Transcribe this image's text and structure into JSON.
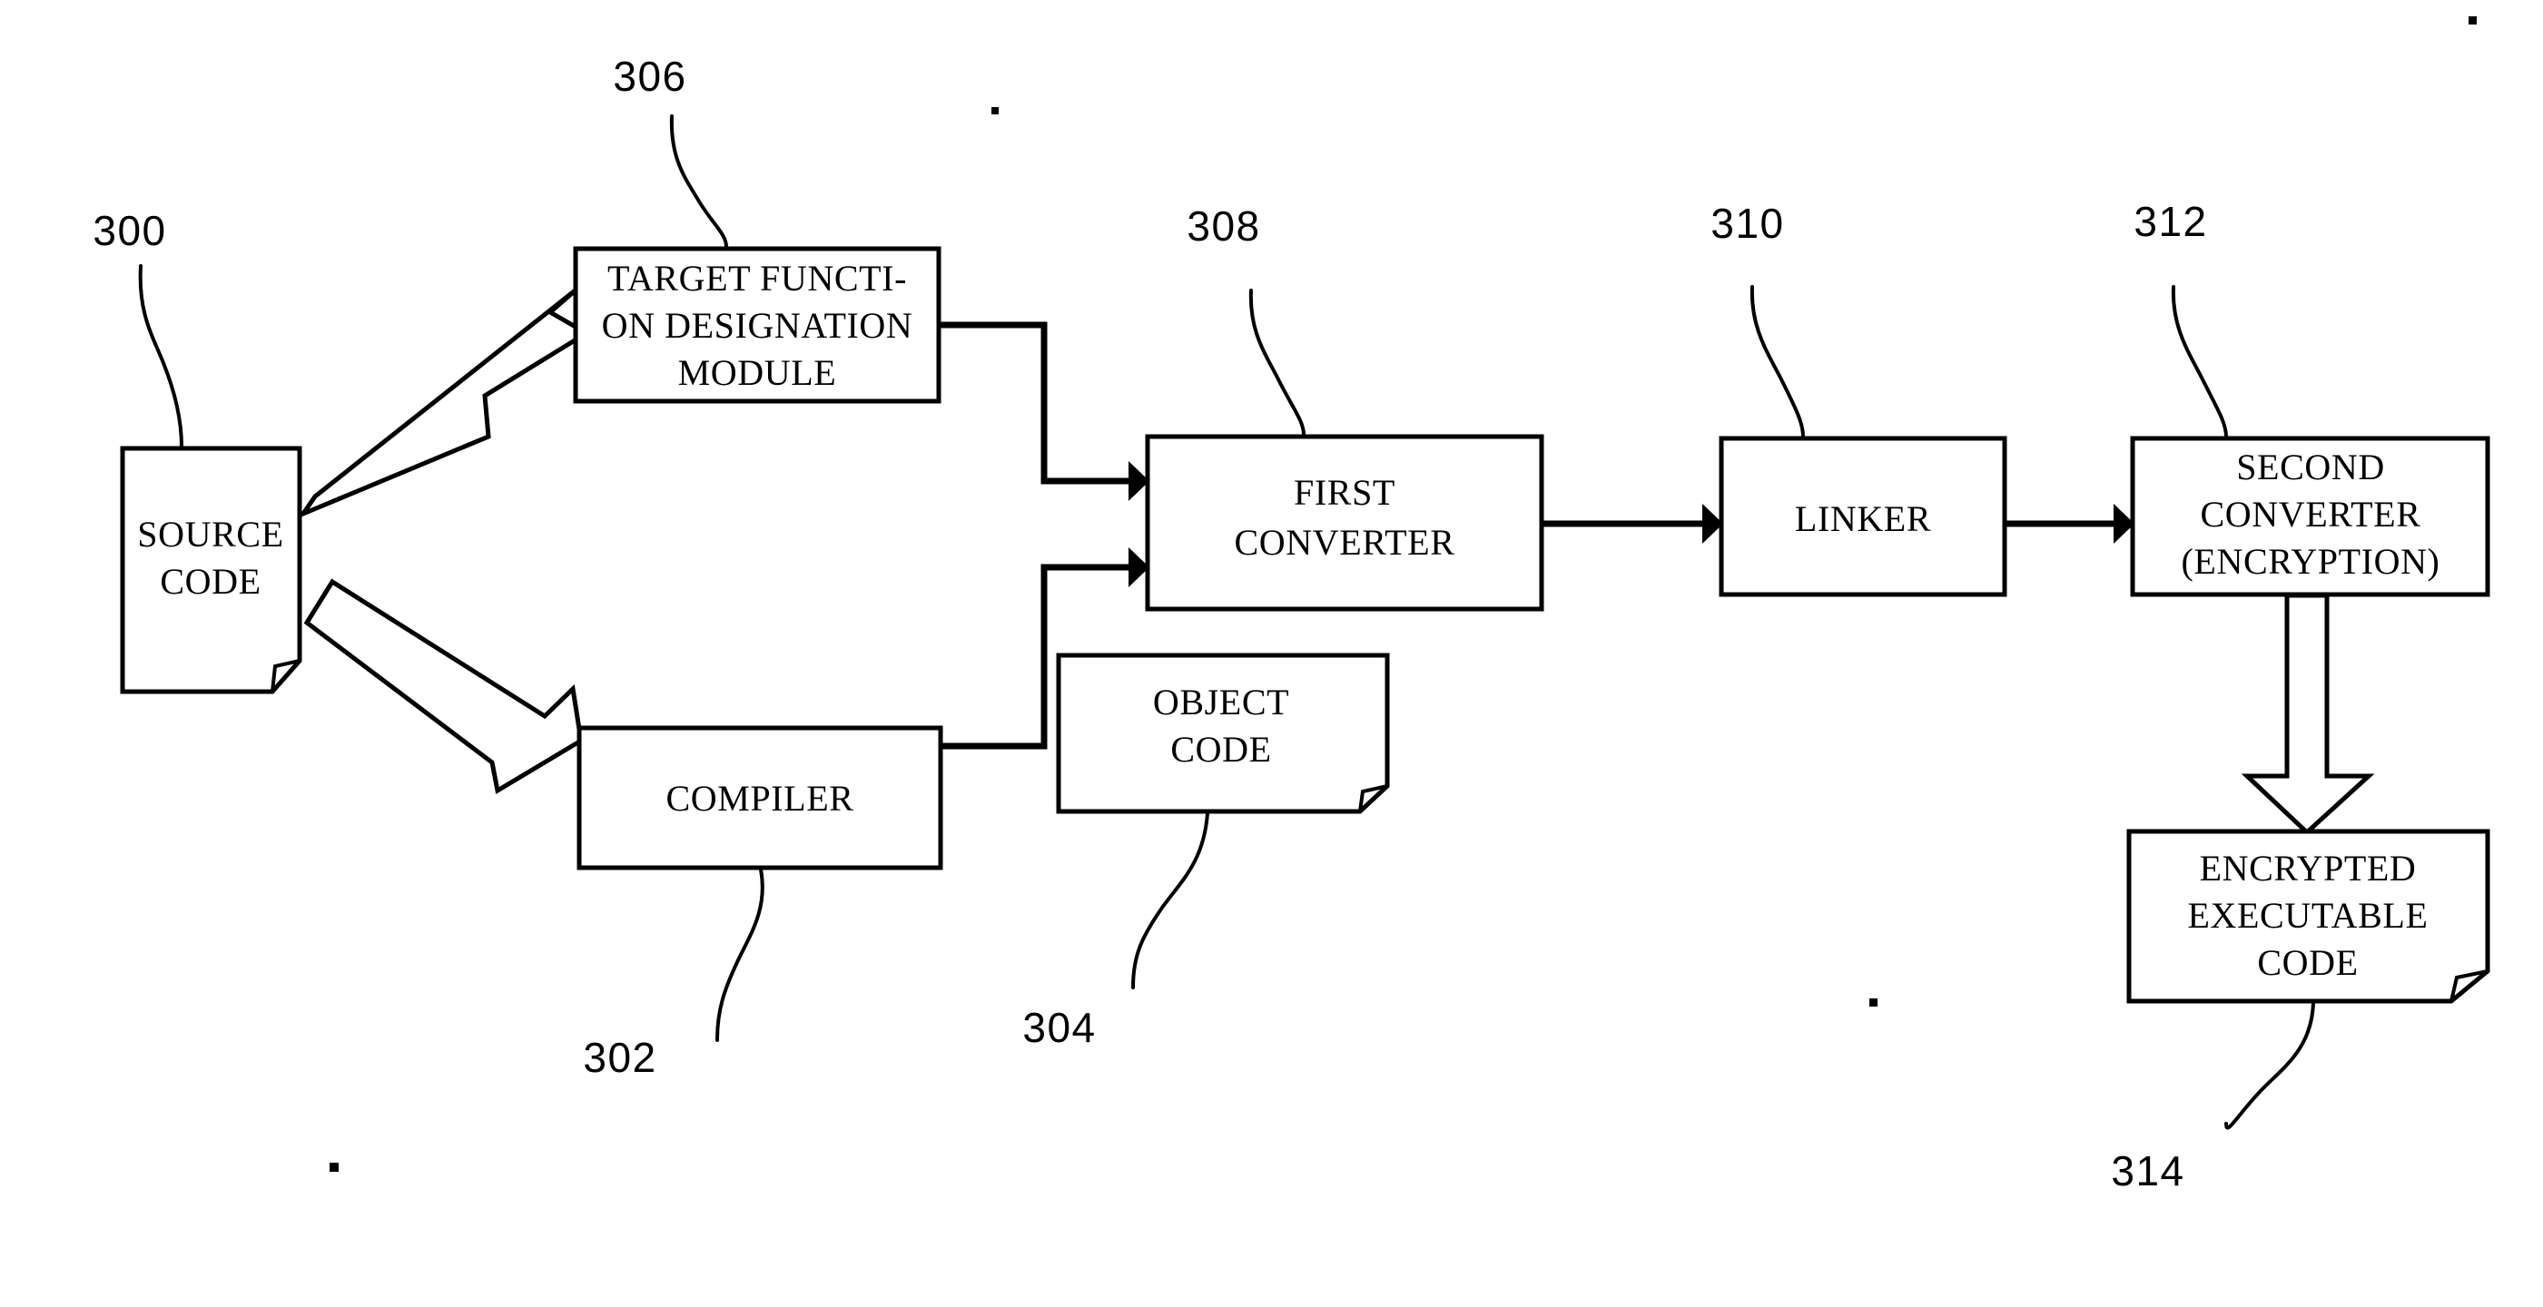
{
  "figure": {
    "title": "Software encryption build flow diagram",
    "background_color": "#ffffff",
    "line_color": "#000000"
  },
  "nodes": {
    "source_code": {
      "id": "300",
      "label_lines": [
        "SOURCE",
        "CODE"
      ],
      "shape": "document"
    },
    "target_function_module": {
      "id": "306",
      "label_lines": [
        "TARGET FUNCTI-",
        "ON DESIGNATION",
        "MODULE"
      ],
      "shape": "rectangle"
    },
    "compiler": {
      "id": "302",
      "label_lines": [
        "COMPILER"
      ],
      "shape": "rectangle"
    },
    "object_code": {
      "id": "304",
      "label_lines": [
        "OBJECT",
        "CODE"
      ],
      "shape": "document"
    },
    "first_converter": {
      "id": "308",
      "label_lines": [
        "FIRST",
        "CONVERTER"
      ],
      "shape": "rectangle"
    },
    "linker": {
      "id": "310",
      "label_lines": [
        "LINKER"
      ],
      "shape": "rectangle"
    },
    "second_converter": {
      "id": "312",
      "label_lines": [
        "SECOND",
        "CONVERTER",
        "(ENCRYPTION)"
      ],
      "shape": "rectangle"
    },
    "encrypted_executable_code": {
      "id": "314",
      "label_lines": [
        "ENCRYPTED",
        "EXECUTABLE",
        "CODE"
      ],
      "shape": "document"
    }
  },
  "reference_numbers": {
    "source_code": "300",
    "compiler": "302",
    "object_code": "304",
    "target_function_module": "306",
    "first_converter": "308",
    "linker": "310",
    "second_converter": "312",
    "encrypted_executable_code": "314"
  },
  "labels": {
    "source_code_line_1": "SOURCE",
    "source_code_line_2": "CODE",
    "target_module_line_1": "TARGET FUNCTI-",
    "target_module_line_2": "ON DESIGNATION",
    "target_module_line_3": "MODULE",
    "compiler_line_1": "COMPILER",
    "object_code_line_1": "OBJECT",
    "object_code_line_2": "CODE",
    "first_converter_line_1": "FIRST",
    "first_converter_line_2": "CONVERTER",
    "linker_line_1": "LINKER",
    "second_converter_line_1": "SECOND",
    "second_converter_line_2": "CONVERTER",
    "second_converter_line_3": "(ENCRYPTION)",
    "encrypted_code_line_1": "ENCRYPTED",
    "encrypted_code_line_2": "EXECUTABLE",
    "encrypted_code_line_3": "CODE"
  },
  "connections": [
    {
      "from": "source_code",
      "to": "target_function_module",
      "style": "hollow-block-arrow"
    },
    {
      "from": "source_code",
      "to": "compiler",
      "style": "hollow-block-arrow"
    },
    {
      "from": "target_function_module",
      "to": "first_converter",
      "style": "solid-line-arrow"
    },
    {
      "from": "compiler",
      "to": "first_converter",
      "style": "solid-line-arrow"
    },
    {
      "from": "first_converter",
      "to": "linker",
      "style": "solid-line-arrow"
    },
    {
      "from": "linker",
      "to": "second_converter",
      "style": "solid-line-arrow"
    },
    {
      "from": "second_converter",
      "to": "encrypted_executable_code",
      "style": "hollow-block-arrow"
    }
  ]
}
